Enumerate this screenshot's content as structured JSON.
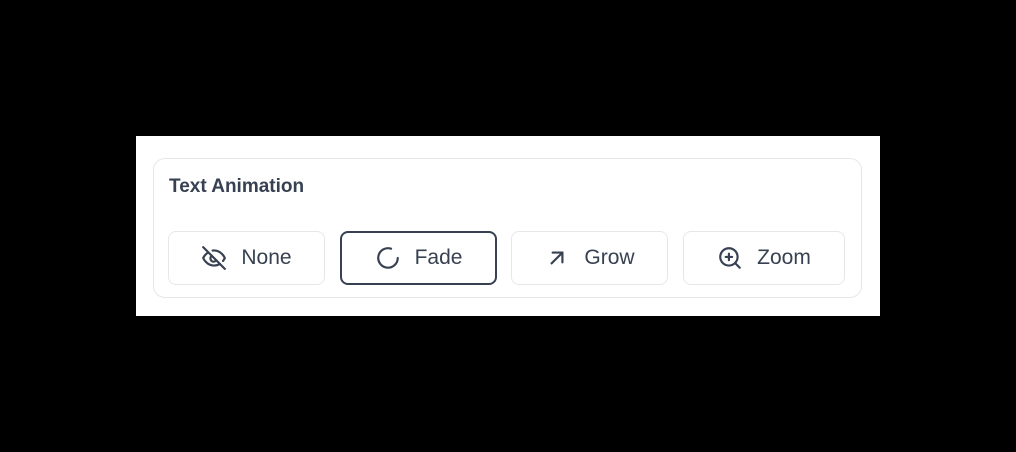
{
  "panel": {
    "title": "Text Animation"
  },
  "options": [
    {
      "label": "None",
      "icon": "eye-off-icon",
      "selected": false
    },
    {
      "label": "Fade",
      "icon": "loader-circle-icon",
      "selected": true
    },
    {
      "label": "Grow",
      "icon": "arrow-up-right-icon",
      "selected": false
    },
    {
      "label": "Zoom",
      "icon": "zoom-in-icon",
      "selected": false
    }
  ],
  "colors": {
    "text": "#374151",
    "border": "#e5e7eb",
    "selected_border": "#374151",
    "background": "#ffffff"
  }
}
